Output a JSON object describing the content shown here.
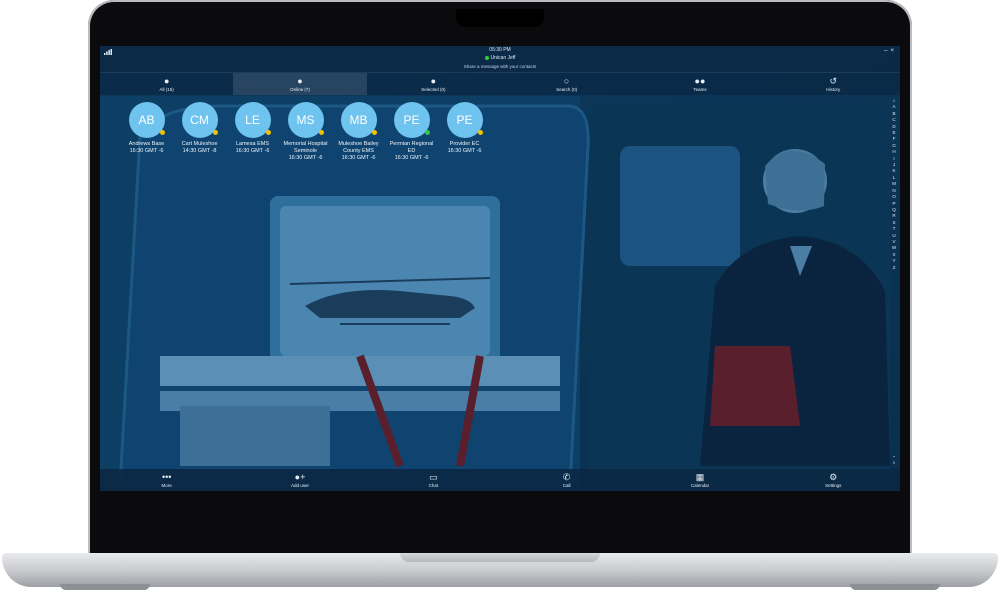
{
  "status": {
    "time": "05:30 PM",
    "user": "Unican Jeff",
    "message_prompt": "Share a message with your contacts"
  },
  "tabs": [
    {
      "icon": "person-icon",
      "label": "All (16)"
    },
    {
      "icon": "person-icon",
      "label": "Online (7)"
    },
    {
      "icon": "person-icon",
      "label": "Selected (0)"
    },
    {
      "icon": "person-outline-icon",
      "label": "Search (0)"
    },
    {
      "icon": "team-icon",
      "label": "Teams"
    },
    {
      "icon": "history-icon",
      "label": "History"
    }
  ],
  "contacts": [
    {
      "initials": "AB",
      "name": "Andrews Base",
      "time": "16:30 GMT -6",
      "presence": "away"
    },
    {
      "initials": "CM",
      "name": "Cart Muleshoe",
      "time": "14:30 GMT -8",
      "presence": "away"
    },
    {
      "initials": "LE",
      "name": "Lamesa EMS",
      "time": "16:30 GMT -6",
      "presence": "away"
    },
    {
      "initials": "MS",
      "name": "Memorial Hospital Seminole",
      "time": "16:30 GMT -6",
      "presence": "away"
    },
    {
      "initials": "MB",
      "name": "Muleshoe Bailey County EMS",
      "time": "16:30 GMT -6",
      "presence": "away"
    },
    {
      "initials": "PE",
      "name": "Permian Regional ED",
      "time": "16:30 GMT -6",
      "presence": "online"
    },
    {
      "initials": "PE",
      "name": "Provider EC",
      "time": "16:30 GMT -6",
      "presence": "away"
    }
  ],
  "alphabet": [
    "A",
    "B",
    "C",
    "D",
    "E",
    "F",
    "G",
    "H",
    "I",
    "J",
    "K",
    "L",
    "M",
    "N",
    "O",
    "P",
    "Q",
    "R",
    "S",
    "T",
    "U",
    "V",
    "W",
    "X",
    "Y",
    "Z"
  ],
  "bottom": [
    {
      "icon": "more-icon",
      "label": "More"
    },
    {
      "icon": "add-user-icon",
      "label": "Add user"
    },
    {
      "icon": "chat-icon",
      "label": "Chat"
    },
    {
      "icon": "phone-icon",
      "label": "Call"
    },
    {
      "icon": "calendar-icon",
      "label": "Calendar"
    },
    {
      "icon": "gear-icon",
      "label": "Settings"
    }
  ],
  "colors": {
    "accent": "#6fc3ef",
    "away": "#f2c200",
    "online": "#2ecc40",
    "screen_tint": "#0e3f66"
  }
}
